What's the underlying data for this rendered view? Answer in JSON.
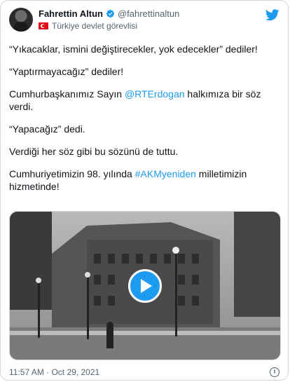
{
  "author": {
    "display_name": "Fahrettin Altun",
    "handle": "@fahrettinaltun",
    "gov_label": "Türkiye devlet görevlisi"
  },
  "tweet": {
    "lines": {
      "p1": "“Yıkacaklar, ismini değiştirecekler, yok edecekler” dediler!",
      "p2": "“Yaptırmayacağız” dediler!",
      "p3_before": "Cumhurbaşkanımız Sayın ",
      "p3_mention": "@RTErdogan",
      "p3_after": " halkımıza bir söz verdi.",
      "p4": "“Yapacağız” dedi.",
      "p5": "Verdiği her söz gibi bu sözünü de tuttu.",
      "p6_before": "Cumhuriyetimizin 98. yılında ",
      "p6_hashtag": "#AKMyeniden",
      "p6_after": " milletimizin hizmetinde!"
    }
  },
  "footer": {
    "timestamp": "11:57 AM · Oct 29, 2021",
    "info_glyph": "i"
  },
  "colors": {
    "accent": "#1d9bf0",
    "text": "#0f1419",
    "muted": "#536471",
    "border": "#cfd9de"
  },
  "icons": [
    "verified-badge-icon",
    "turkey-flag-icon",
    "twitter-bird-icon",
    "play-icon",
    "info-icon"
  ]
}
